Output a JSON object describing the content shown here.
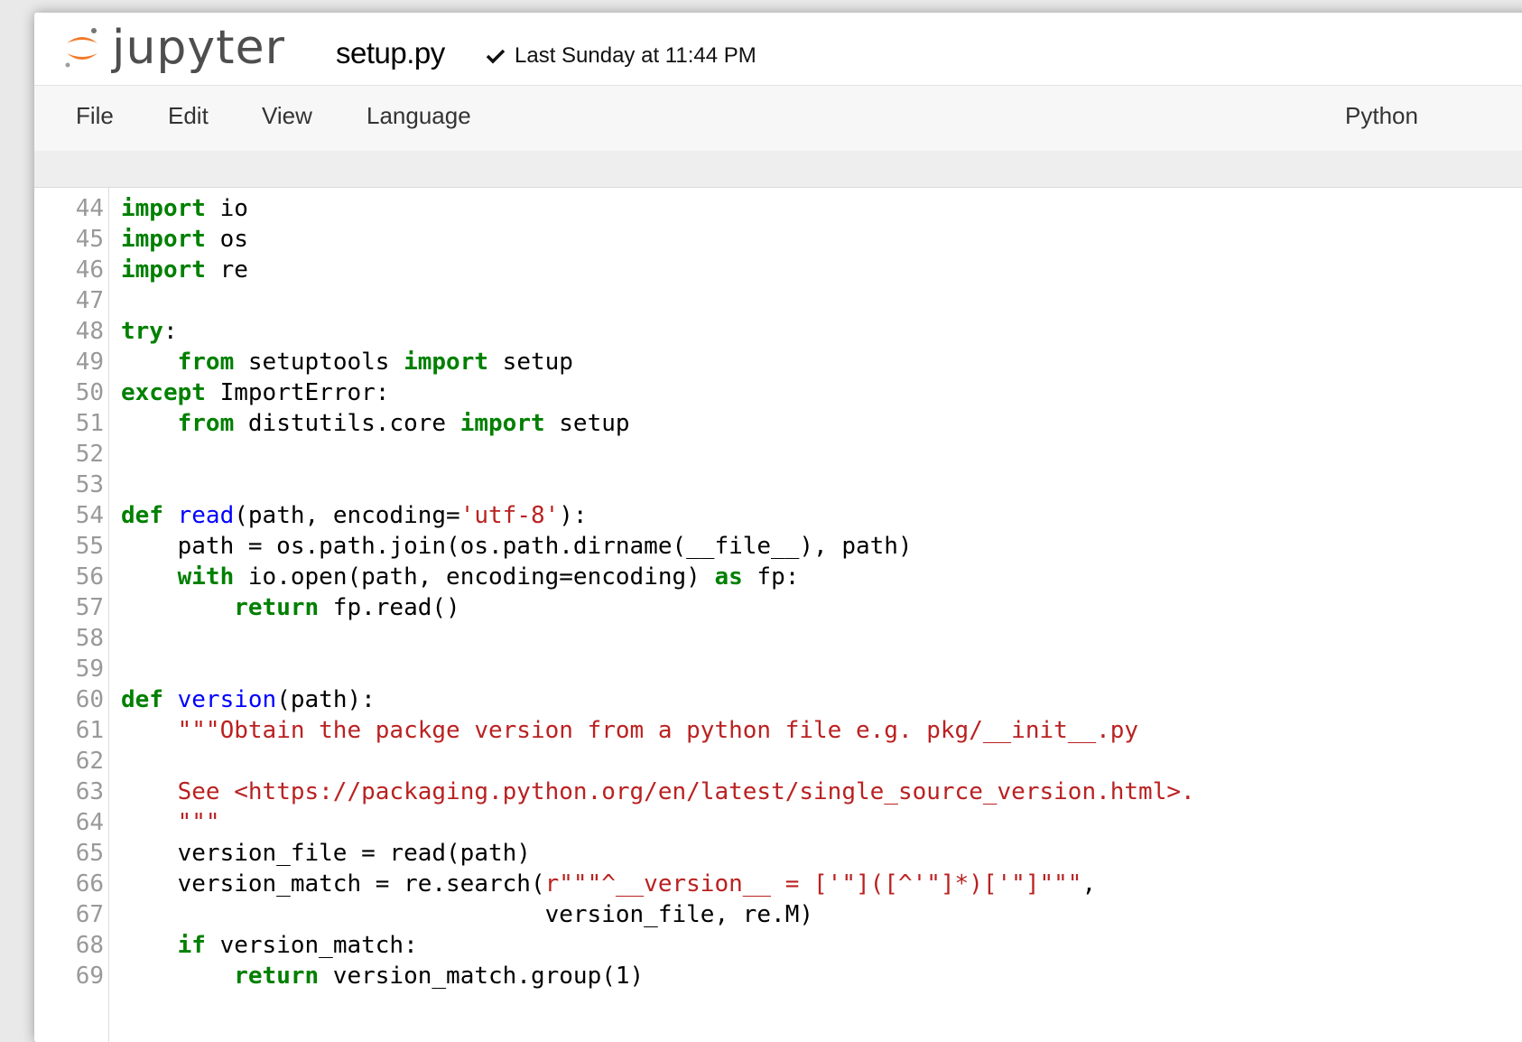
{
  "header": {
    "logo_text": "jupyter",
    "notebook_name": "setup.py",
    "checkpoint": "Last Sunday at 11:44 PM"
  },
  "menubar": {
    "items": [
      "File",
      "Edit",
      "View",
      "Language"
    ],
    "mode": "Python"
  },
  "editor": {
    "lines": [
      {
        "n": "44",
        "t": [
          [
            "kw",
            "import"
          ],
          [
            "p",
            " io"
          ]
        ]
      },
      {
        "n": "45",
        "t": [
          [
            "kw",
            "import"
          ],
          [
            "p",
            " os"
          ]
        ]
      },
      {
        "n": "46",
        "t": [
          [
            "kw",
            "import"
          ],
          [
            "p",
            " re"
          ]
        ]
      },
      {
        "n": "47",
        "t": []
      },
      {
        "n": "48",
        "t": [
          [
            "kw",
            "try"
          ],
          [
            "p",
            ":"
          ]
        ]
      },
      {
        "n": "49",
        "t": [
          [
            "p",
            "    "
          ],
          [
            "kw",
            "from"
          ],
          [
            "p",
            " setuptools "
          ],
          [
            "kw",
            "import"
          ],
          [
            "p",
            " setup"
          ]
        ]
      },
      {
        "n": "50",
        "t": [
          [
            "kw",
            "except"
          ],
          [
            "p",
            " ImportError:"
          ]
        ]
      },
      {
        "n": "51",
        "t": [
          [
            "p",
            "    "
          ],
          [
            "kw",
            "from"
          ],
          [
            "p",
            " distutils.core "
          ],
          [
            "kw",
            "import"
          ],
          [
            "p",
            " setup"
          ]
        ]
      },
      {
        "n": "52",
        "t": []
      },
      {
        "n": "53",
        "t": []
      },
      {
        "n": "54",
        "t": [
          [
            "kw",
            "def"
          ],
          [
            "p",
            " "
          ],
          [
            "def",
            "read"
          ],
          [
            "p",
            "(path, encoding="
          ],
          [
            "str",
            "'utf-8'"
          ],
          [
            "p",
            "):"
          ]
        ]
      },
      {
        "n": "55",
        "t": [
          [
            "p",
            "    path = os.path.join(os.path.dirname(__file__), path)"
          ]
        ]
      },
      {
        "n": "56",
        "t": [
          [
            "p",
            "    "
          ],
          [
            "kw",
            "with"
          ],
          [
            "p",
            " io.open(path, encoding=encoding) "
          ],
          [
            "kw",
            "as"
          ],
          [
            "p",
            " fp:"
          ]
        ]
      },
      {
        "n": "57",
        "t": [
          [
            "p",
            "        "
          ],
          [
            "kw",
            "return"
          ],
          [
            "p",
            " fp.read()"
          ]
        ]
      },
      {
        "n": "58",
        "t": []
      },
      {
        "n": "59",
        "t": []
      },
      {
        "n": "60",
        "t": [
          [
            "kw",
            "def"
          ],
          [
            "p",
            " "
          ],
          [
            "def",
            "version"
          ],
          [
            "p",
            "(path):"
          ]
        ]
      },
      {
        "n": "61",
        "t": [
          [
            "p",
            "    "
          ],
          [
            "str",
            "\"\"\"Obtain the packge version from a python file e.g. pkg/__init__.py"
          ]
        ]
      },
      {
        "n": "62",
        "t": []
      },
      {
        "n": "63",
        "t": [
          [
            "p",
            "    "
          ],
          [
            "str",
            "See <https://packaging.python.org/en/latest/single_source_version.html>."
          ]
        ]
      },
      {
        "n": "64",
        "t": [
          [
            "p",
            "    "
          ],
          [
            "str",
            "\"\"\""
          ]
        ]
      },
      {
        "n": "65",
        "t": [
          [
            "p",
            "    version_file = read(path)"
          ]
        ]
      },
      {
        "n": "66",
        "t": [
          [
            "p",
            "    version_match = re.search("
          ],
          [
            "str",
            "r\"\"\"^__version__ = ['\"]([^'\"]*)['\"]\"\"\""
          ],
          [
            "p",
            ","
          ]
        ]
      },
      {
        "n": "67",
        "t": [
          [
            "p",
            "                              version_file, re.M)"
          ]
        ]
      },
      {
        "n": "68",
        "t": [
          [
            "p",
            "    "
          ],
          [
            "kw",
            "if"
          ],
          [
            "p",
            " version_match:"
          ]
        ]
      },
      {
        "n": "69",
        "t": [
          [
            "p",
            "        "
          ],
          [
            "kw",
            "return"
          ],
          [
            "p",
            " version_match.group(1)"
          ]
        ]
      }
    ]
  },
  "colors": {
    "keyword": "#008000",
    "def_name": "#0000ff",
    "string": "#ba2121",
    "line_number": "#999999",
    "logo_orange": "#f37726"
  }
}
